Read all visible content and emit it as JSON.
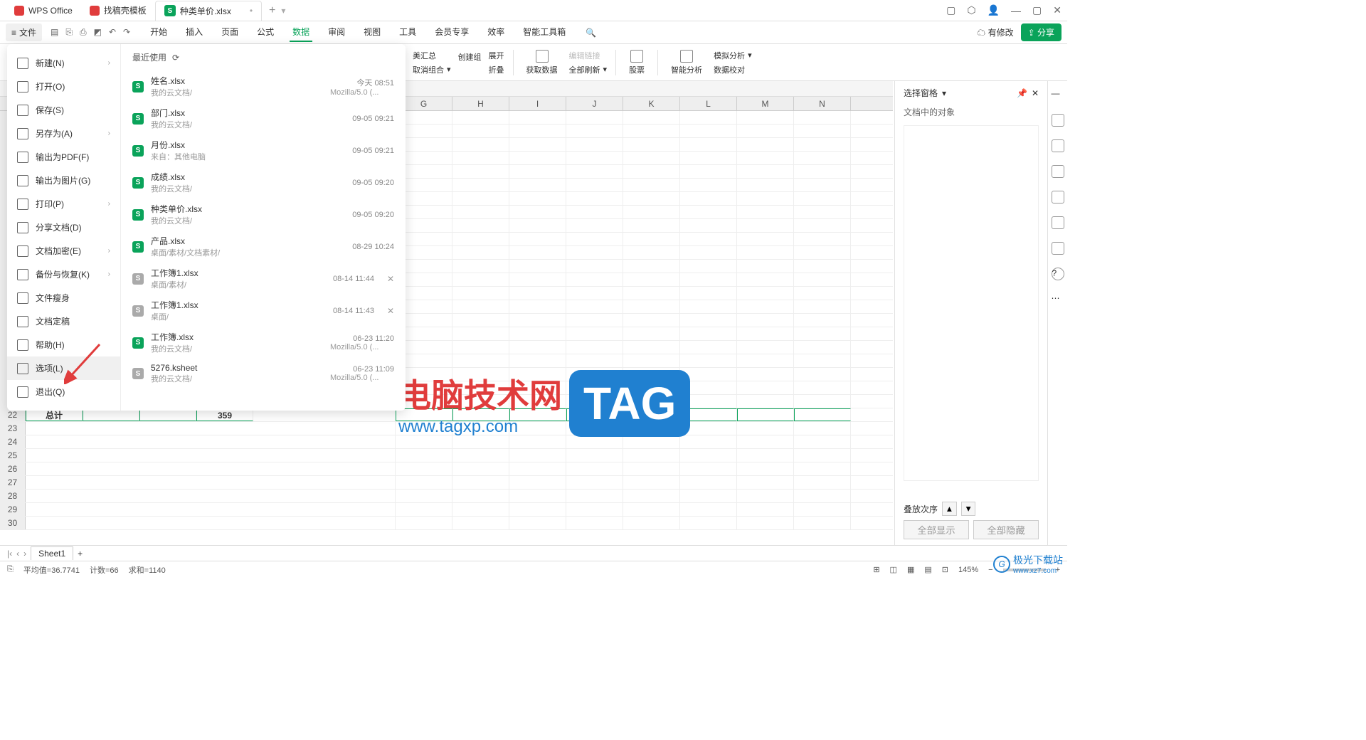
{
  "titlebar": {
    "app": "WPS Office",
    "tab1": "找稿壳模板",
    "tab2": "种类单价.xlsx"
  },
  "menubar": {
    "file": "文件",
    "tabs": [
      "开始",
      "插入",
      "页面",
      "公式",
      "数据",
      "审阅",
      "视图",
      "工具",
      "会员专享",
      "效率",
      "智能工具箱"
    ],
    "active_tab": "数据",
    "modified": "有修改",
    "share": "分享"
  },
  "ribbon": {
    "items": [
      "美汇总",
      "取消组合",
      "创建组",
      "展开",
      "折叠",
      "获取数据",
      "全部刷新",
      "编辑链接",
      "股票",
      "智能分析",
      "模拟分析",
      "数据校对"
    ]
  },
  "file_menu": {
    "items": [
      {
        "label": "新建(N)",
        "arrow": true
      },
      {
        "label": "打开(O)",
        "arrow": false
      },
      {
        "label": "保存(S)",
        "arrow": false
      },
      {
        "label": "另存为(A)",
        "arrow": true
      },
      {
        "label": "输出为PDF(F)",
        "arrow": false
      },
      {
        "label": "输出为图片(G)",
        "arrow": false
      },
      {
        "label": "打印(P)",
        "arrow": true
      },
      {
        "label": "分享文档(D)",
        "arrow": false
      },
      {
        "label": "文档加密(E)",
        "arrow": true
      },
      {
        "label": "备份与恢复(K)",
        "arrow": true
      },
      {
        "label": "文件瘦身",
        "arrow": false
      },
      {
        "label": "文档定稿",
        "arrow": false
      },
      {
        "label": "帮助(H)",
        "arrow": false
      },
      {
        "label": "选项(L)",
        "arrow": false,
        "hover": true
      },
      {
        "label": "退出(Q)",
        "arrow": false
      }
    ],
    "recent_header": "最近使用",
    "recent": [
      {
        "name": "姓名.xlsx",
        "path": "我的云文档/",
        "time": "今天 08:51",
        "sub": "Mozilla/5.0 (...",
        "green": true
      },
      {
        "name": "部门.xlsx",
        "path": "我的云文档/",
        "time": "09-05 09:21",
        "green": true
      },
      {
        "name": "月份.xlsx",
        "path": "来自：其他电脑",
        "time": "09-05 09:21",
        "green": true
      },
      {
        "name": "成绩.xlsx",
        "path": "我的云文档/",
        "time": "09-05 09:20",
        "green": true
      },
      {
        "name": "种类单价.xlsx",
        "path": "我的云文档/",
        "time": "09-05 09:20",
        "green": true
      },
      {
        "name": "产品.xlsx",
        "path": "桌面/素材/文档素材/",
        "time": "08-29 10:24",
        "green": true
      },
      {
        "name": "工作簿1.xlsx",
        "path": "桌面/素材/",
        "time": "08-14 11:44",
        "green": false,
        "close": true
      },
      {
        "name": "工作簿1.xlsx",
        "path": "桌面/",
        "time": "08-14 11:43",
        "green": false,
        "close": true
      },
      {
        "name": "工作簿.xlsx",
        "path": "我的云文档/",
        "time": "06-23 11:20",
        "sub": "Mozilla/5.0 (...",
        "green": true
      },
      {
        "name": "5276.ksheet",
        "path": "我的云文档/",
        "time": "06-23 11:09",
        "sub": "Mozilla/5.0 (...",
        "green": false
      }
    ]
  },
  "chart_data": {
    "type": "table",
    "visible_rows": [
      22,
      23,
      24,
      25,
      26,
      27,
      28,
      29,
      30
    ],
    "row22": {
      "A": "总计",
      "D": "359"
    }
  },
  "columns": [
    "G",
    "H",
    "I",
    "J",
    "K",
    "L",
    "M",
    "N"
  ],
  "right_panel": {
    "title": "选择窗格",
    "subtitle": "文档中的对象",
    "order": "叠放次序",
    "show_all": "全部显示",
    "hide_all": "全部隐藏"
  },
  "sheet_tabs": {
    "sheet1": "Sheet1"
  },
  "status": {
    "avg": "平均值=36.7741",
    "count": "计数=66",
    "sum": "求和=1140",
    "zoom": "145%"
  },
  "watermark": {
    "cn": "电脑技术网",
    "url": "www.tagxp.com",
    "tag": "TAG"
  },
  "badge": {
    "name": "极光下载站",
    "url": "www.xz7.com"
  }
}
